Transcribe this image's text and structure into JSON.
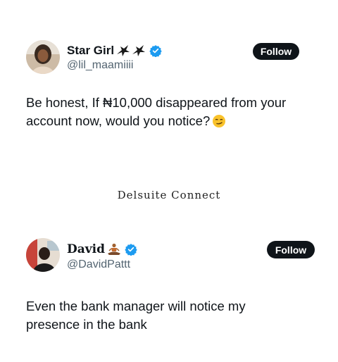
{
  "post1": {
    "display_name": "Star Girl",
    "handle": "@lil_maamiiii",
    "follow_label": "Follow",
    "text_line1": "Be honest, If ₦10,000 disappeared from your",
    "text_line2": "account now, would you notice?",
    "name_icons": [
      "bird-icon",
      "bird-icon",
      "verified-badge-icon"
    ],
    "text_emoji": "smirking-face-emoji"
  },
  "watermark": {
    "text": "Delsuite Connect"
  },
  "post2": {
    "display_name": "David",
    "handle": "@DavidPattt",
    "follow_label": "Follow",
    "text_line1": "Even the bank manager will notice my",
    "text_line2": "presence in the bank",
    "name_icons": [
      "meditating-person-emoji",
      "verified-badge-icon"
    ]
  },
  "colors": {
    "text": "#0f1419",
    "secondary_text": "#536471",
    "verified": "#1d9bf0",
    "button_bg": "#0f1419",
    "button_text": "#ffffff",
    "background": "#ffffff"
  }
}
